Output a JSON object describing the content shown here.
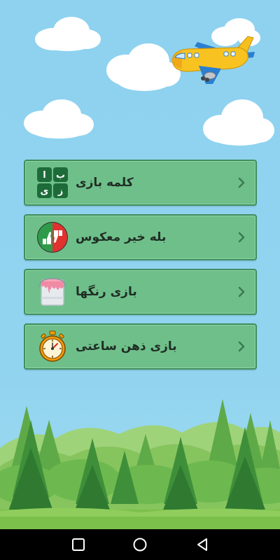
{
  "menu": {
    "items": [
      {
        "label": "کلمه بازی",
        "icon": "letter-tiles-icon",
        "tiles": [
          "ب",
          "ا",
          "ز",
          "ی"
        ]
      },
      {
        "label": "بله خیر معکوس",
        "icon": "thumbs-up-down-icon"
      },
      {
        "label": "بازی رنگها",
        "icon": "paint-bucket-icon"
      },
      {
        "label": "بازی ذهن ساعتی",
        "icon": "stopwatch-icon"
      }
    ]
  },
  "colors": {
    "sky": "#8fd3f0",
    "button_fill": "#6fbf8a",
    "button_border": "#3f8d5d",
    "label_text": "#1f2d24"
  },
  "navbar": {
    "buttons": [
      "recent-apps-icon",
      "home-icon",
      "back-icon"
    ]
  }
}
